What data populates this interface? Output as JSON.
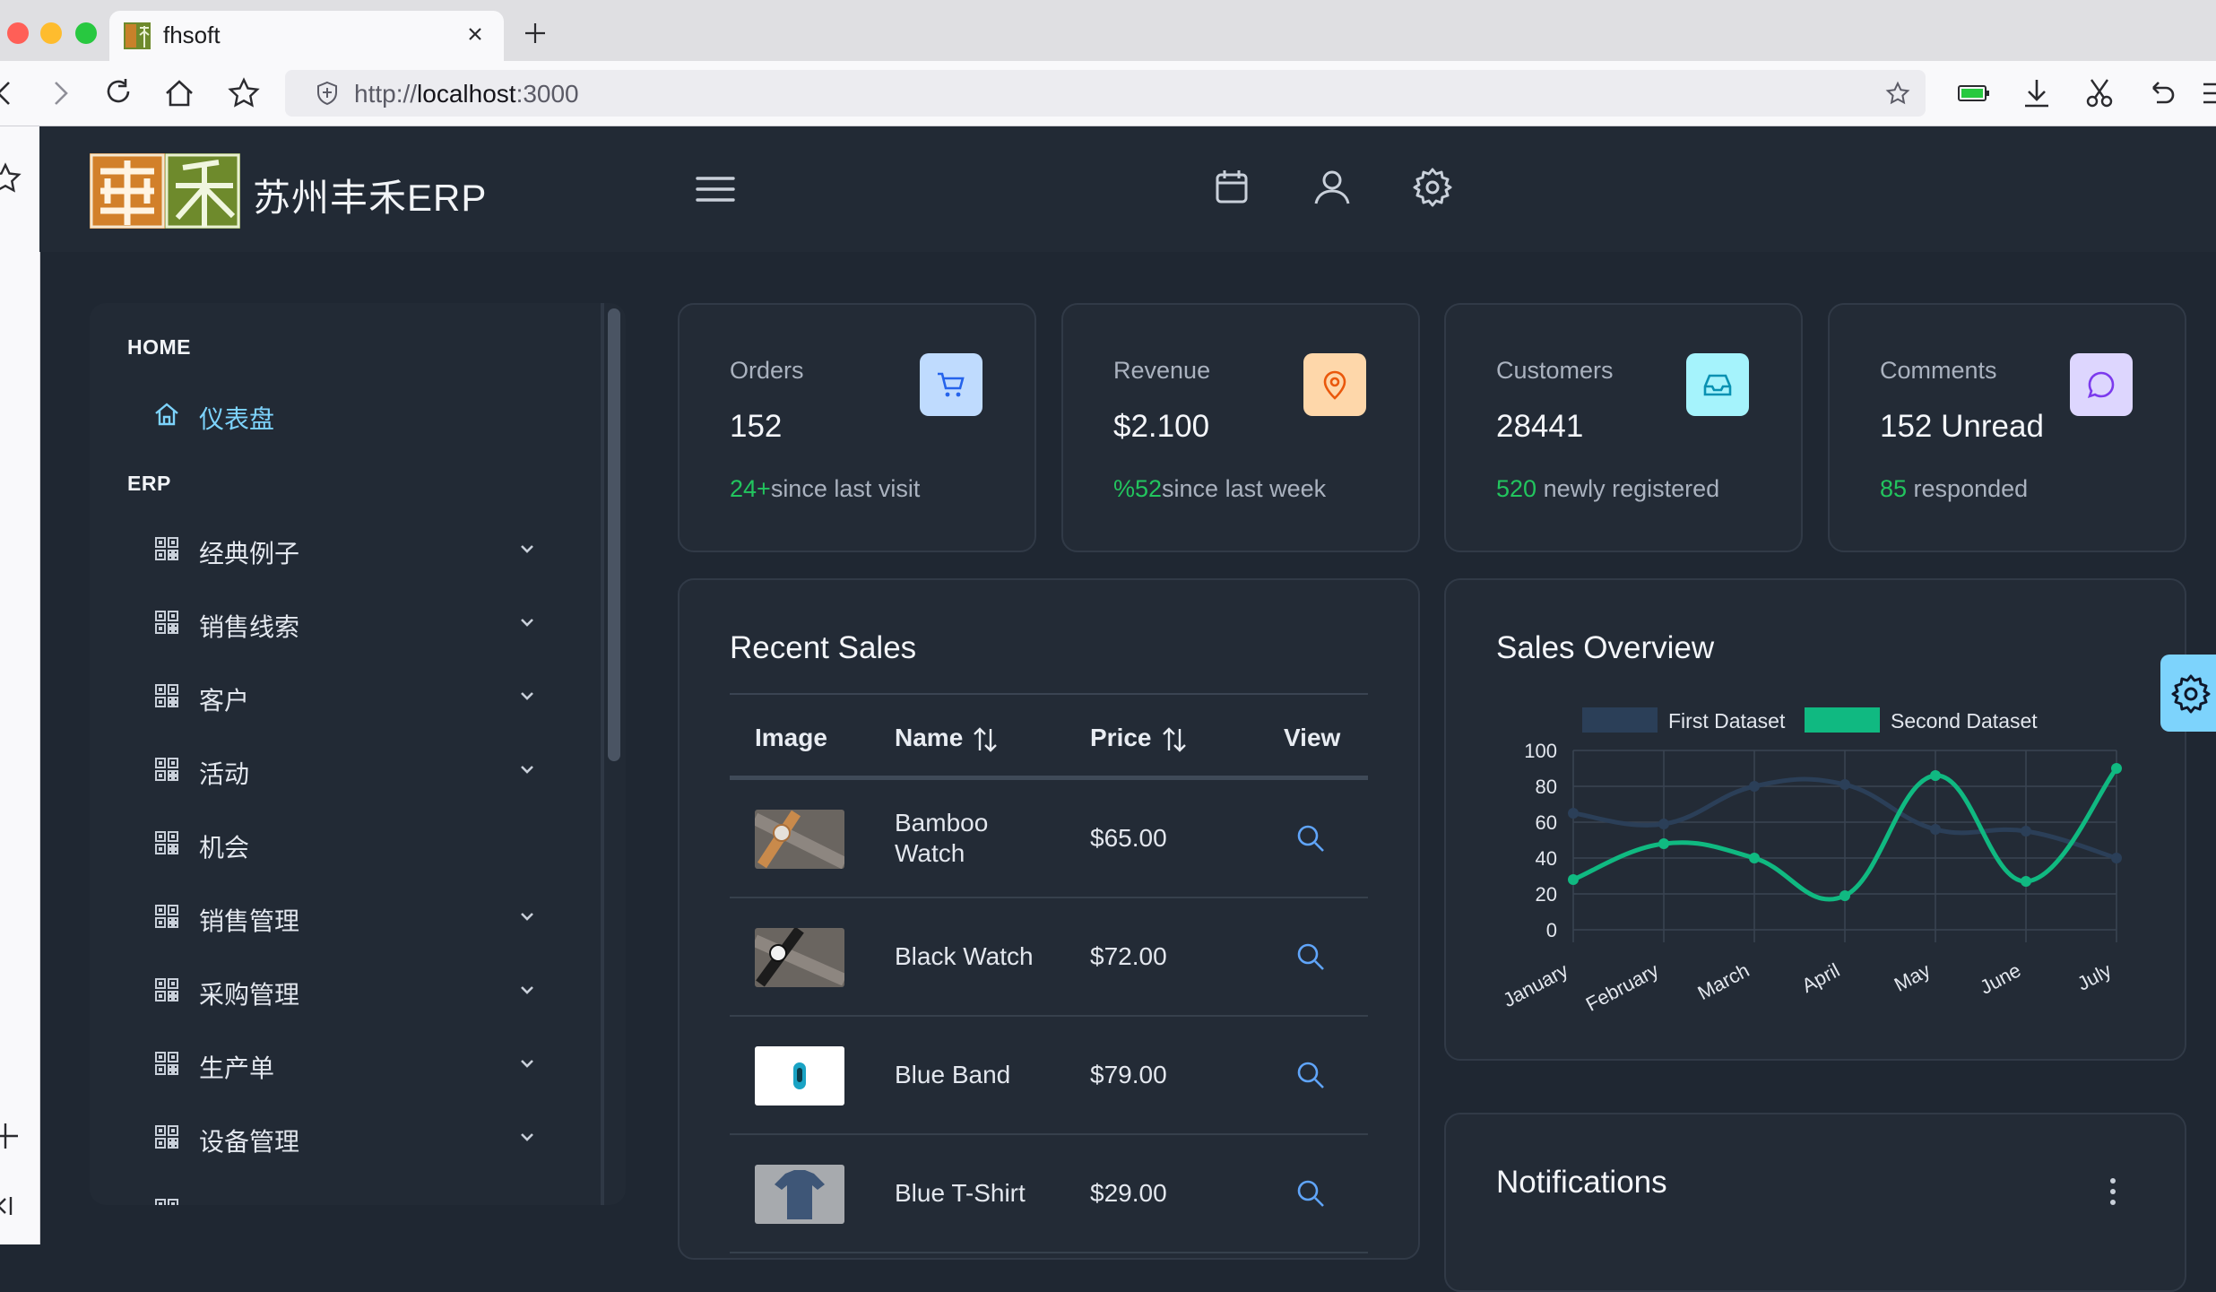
{
  "browser": {
    "tab_title": "fhsoft",
    "url_scheme": "http://",
    "url_host": "localhost",
    "url_port": ":3000"
  },
  "header": {
    "brand": "苏州丰禾ERP"
  },
  "sidebar": {
    "sections": [
      {
        "label": "HOME"
      },
      {
        "label": "ERP"
      }
    ],
    "home_item": {
      "label": "仪表盘",
      "icon": "home-icon"
    },
    "erp_items": [
      {
        "label": "经典例子",
        "icon": "qrcode-icon",
        "expandable": true
      },
      {
        "label": "销售线索",
        "icon": "qrcode-icon",
        "expandable": true
      },
      {
        "label": "客户",
        "icon": "qrcode-icon",
        "expandable": true
      },
      {
        "label": "活动",
        "icon": "qrcode-icon",
        "expandable": true
      },
      {
        "label": "机会",
        "icon": "qrcode-icon",
        "expandable": false
      },
      {
        "label": "销售管理",
        "icon": "qrcode-icon",
        "expandable": true
      },
      {
        "label": "采购管理",
        "icon": "qrcode-icon",
        "expandable": true
      },
      {
        "label": "生产单",
        "icon": "qrcode-icon",
        "expandable": true
      },
      {
        "label": "设备管理",
        "icon": "qrcode-icon",
        "expandable": true
      }
    ]
  },
  "stats": [
    {
      "title": "Orders",
      "value": "152",
      "highlight": "24+",
      "note": "since last visit",
      "icon": "cart-icon",
      "color": "#bfdbfe"
    },
    {
      "title": "Revenue",
      "value": "$2.100",
      "highlight": "%52",
      "note": "since last week",
      "icon": "map-pin-icon",
      "color": "#fed7aa"
    },
    {
      "title": "Customers",
      "value": "28441",
      "highlight": "520",
      "note": " newly registered",
      "icon": "inbox-icon",
      "color": "#a5f3fc"
    },
    {
      "title": "Comments",
      "value": "152 Unread",
      "highlight": "85",
      "note": " responded",
      "icon": "comment-icon",
      "color": "#ddd6fe"
    }
  ],
  "recent_sales": {
    "title": "Recent Sales",
    "columns": [
      "Image",
      "Name",
      "Price",
      "View"
    ],
    "rows": [
      {
        "name": "Bamboo Watch",
        "price": "$65.00"
      },
      {
        "name": "Black Watch",
        "price": "$72.00"
      },
      {
        "name": "Blue Band",
        "price": "$79.00"
      },
      {
        "name": "Blue T-Shirt",
        "price": "$29.00"
      }
    ]
  },
  "sales_overview": {
    "title": "Sales Overview"
  },
  "notifications": {
    "title": "Notifications"
  },
  "chart_data": {
    "type": "line",
    "title": "Sales Overview",
    "categories": [
      "January",
      "February",
      "March",
      "April",
      "May",
      "June",
      "July"
    ],
    "series": [
      {
        "name": "First Dataset",
        "values": [
          65,
          59,
          80,
          81,
          56,
          55,
          40
        ],
        "color": "#2b3f58"
      },
      {
        "name": "Second Dataset",
        "values": [
          28,
          48,
          40,
          19,
          86,
          27,
          90
        ],
        "color": "#10b981"
      }
    ],
    "ylim": [
      0,
      100
    ],
    "yticks": [
      "0",
      "20",
      "40",
      "60",
      "80",
      "100"
    ],
    "grid": true,
    "legend": "top"
  }
}
